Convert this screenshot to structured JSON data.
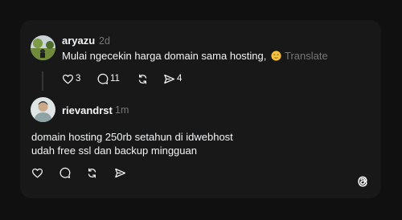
{
  "post": {
    "username": "aryazu",
    "time": "2d",
    "text": "Mulai ngecekin harga domain sama hosting,",
    "translate_label": "Translate",
    "likes": "3",
    "replies": "11",
    "shares": "4"
  },
  "reply": {
    "username": "rievandrst",
    "time": "1m",
    "line1": "domain hosting 250rb setahun di idwebhost",
    "line2": "udah free ssl dan backup mingguan"
  },
  "icons": {
    "like": "heart-icon",
    "reply": "comment-icon",
    "repost": "repost-icon",
    "share": "send-icon",
    "logo": "threads-logo-icon",
    "emoji": "relieved-face-emoji"
  },
  "colors": {
    "background": "#101010",
    "card": "#181818",
    "text": "#f3f5f7",
    "muted": "#777777"
  }
}
